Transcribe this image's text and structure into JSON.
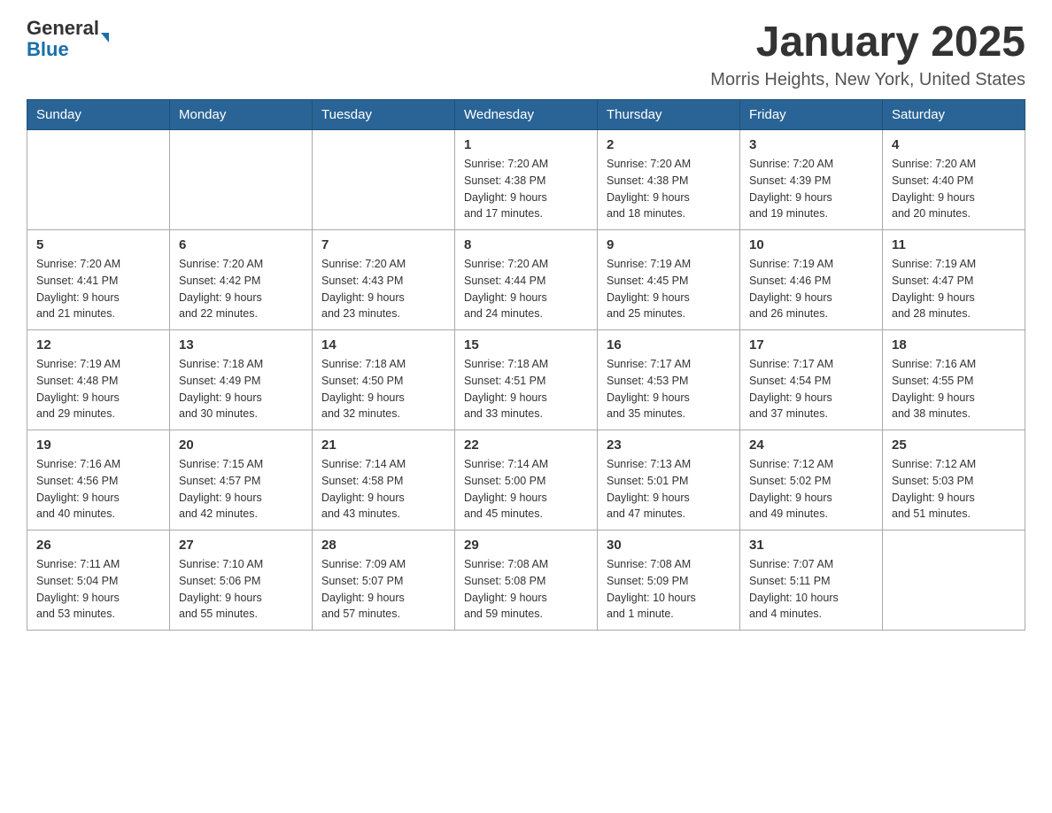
{
  "header": {
    "logo_line1": "General",
    "logo_line2": "Blue",
    "title": "January 2025",
    "subtitle": "Morris Heights, New York, United States"
  },
  "days_of_week": [
    "Sunday",
    "Monday",
    "Tuesday",
    "Wednesday",
    "Thursday",
    "Friday",
    "Saturday"
  ],
  "weeks": [
    [
      {
        "day": "",
        "info": ""
      },
      {
        "day": "",
        "info": ""
      },
      {
        "day": "",
        "info": ""
      },
      {
        "day": "1",
        "info": "Sunrise: 7:20 AM\nSunset: 4:38 PM\nDaylight: 9 hours\nand 17 minutes."
      },
      {
        "day": "2",
        "info": "Sunrise: 7:20 AM\nSunset: 4:38 PM\nDaylight: 9 hours\nand 18 minutes."
      },
      {
        "day": "3",
        "info": "Sunrise: 7:20 AM\nSunset: 4:39 PM\nDaylight: 9 hours\nand 19 minutes."
      },
      {
        "day": "4",
        "info": "Sunrise: 7:20 AM\nSunset: 4:40 PM\nDaylight: 9 hours\nand 20 minutes."
      }
    ],
    [
      {
        "day": "5",
        "info": "Sunrise: 7:20 AM\nSunset: 4:41 PM\nDaylight: 9 hours\nand 21 minutes."
      },
      {
        "day": "6",
        "info": "Sunrise: 7:20 AM\nSunset: 4:42 PM\nDaylight: 9 hours\nand 22 minutes."
      },
      {
        "day": "7",
        "info": "Sunrise: 7:20 AM\nSunset: 4:43 PM\nDaylight: 9 hours\nand 23 minutes."
      },
      {
        "day": "8",
        "info": "Sunrise: 7:20 AM\nSunset: 4:44 PM\nDaylight: 9 hours\nand 24 minutes."
      },
      {
        "day": "9",
        "info": "Sunrise: 7:19 AM\nSunset: 4:45 PM\nDaylight: 9 hours\nand 25 minutes."
      },
      {
        "day": "10",
        "info": "Sunrise: 7:19 AM\nSunset: 4:46 PM\nDaylight: 9 hours\nand 26 minutes."
      },
      {
        "day": "11",
        "info": "Sunrise: 7:19 AM\nSunset: 4:47 PM\nDaylight: 9 hours\nand 28 minutes."
      }
    ],
    [
      {
        "day": "12",
        "info": "Sunrise: 7:19 AM\nSunset: 4:48 PM\nDaylight: 9 hours\nand 29 minutes."
      },
      {
        "day": "13",
        "info": "Sunrise: 7:18 AM\nSunset: 4:49 PM\nDaylight: 9 hours\nand 30 minutes."
      },
      {
        "day": "14",
        "info": "Sunrise: 7:18 AM\nSunset: 4:50 PM\nDaylight: 9 hours\nand 32 minutes."
      },
      {
        "day": "15",
        "info": "Sunrise: 7:18 AM\nSunset: 4:51 PM\nDaylight: 9 hours\nand 33 minutes."
      },
      {
        "day": "16",
        "info": "Sunrise: 7:17 AM\nSunset: 4:53 PM\nDaylight: 9 hours\nand 35 minutes."
      },
      {
        "day": "17",
        "info": "Sunrise: 7:17 AM\nSunset: 4:54 PM\nDaylight: 9 hours\nand 37 minutes."
      },
      {
        "day": "18",
        "info": "Sunrise: 7:16 AM\nSunset: 4:55 PM\nDaylight: 9 hours\nand 38 minutes."
      }
    ],
    [
      {
        "day": "19",
        "info": "Sunrise: 7:16 AM\nSunset: 4:56 PM\nDaylight: 9 hours\nand 40 minutes."
      },
      {
        "day": "20",
        "info": "Sunrise: 7:15 AM\nSunset: 4:57 PM\nDaylight: 9 hours\nand 42 minutes."
      },
      {
        "day": "21",
        "info": "Sunrise: 7:14 AM\nSunset: 4:58 PM\nDaylight: 9 hours\nand 43 minutes."
      },
      {
        "day": "22",
        "info": "Sunrise: 7:14 AM\nSunset: 5:00 PM\nDaylight: 9 hours\nand 45 minutes."
      },
      {
        "day": "23",
        "info": "Sunrise: 7:13 AM\nSunset: 5:01 PM\nDaylight: 9 hours\nand 47 minutes."
      },
      {
        "day": "24",
        "info": "Sunrise: 7:12 AM\nSunset: 5:02 PM\nDaylight: 9 hours\nand 49 minutes."
      },
      {
        "day": "25",
        "info": "Sunrise: 7:12 AM\nSunset: 5:03 PM\nDaylight: 9 hours\nand 51 minutes."
      }
    ],
    [
      {
        "day": "26",
        "info": "Sunrise: 7:11 AM\nSunset: 5:04 PM\nDaylight: 9 hours\nand 53 minutes."
      },
      {
        "day": "27",
        "info": "Sunrise: 7:10 AM\nSunset: 5:06 PM\nDaylight: 9 hours\nand 55 minutes."
      },
      {
        "day": "28",
        "info": "Sunrise: 7:09 AM\nSunset: 5:07 PM\nDaylight: 9 hours\nand 57 minutes."
      },
      {
        "day": "29",
        "info": "Sunrise: 7:08 AM\nSunset: 5:08 PM\nDaylight: 9 hours\nand 59 minutes."
      },
      {
        "day": "30",
        "info": "Sunrise: 7:08 AM\nSunset: 5:09 PM\nDaylight: 10 hours\nand 1 minute."
      },
      {
        "day": "31",
        "info": "Sunrise: 7:07 AM\nSunset: 5:11 PM\nDaylight: 10 hours\nand 4 minutes."
      },
      {
        "day": "",
        "info": ""
      }
    ]
  ]
}
